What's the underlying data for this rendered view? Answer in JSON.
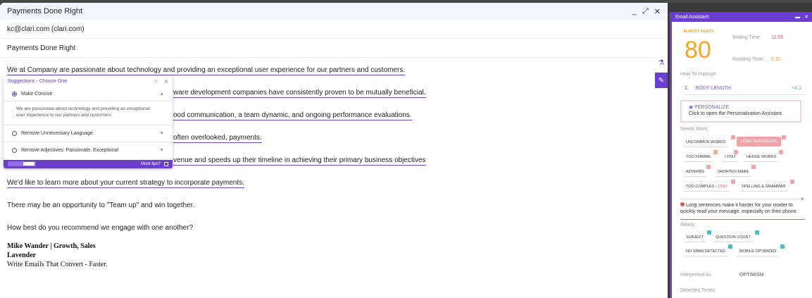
{
  "compose": {
    "title": "Payments Done Right",
    "to": "kc@clari.com (clari.com)",
    "subject": "Payments Done Right",
    "paragraphs": [
      "We at Company are passionate about technology and providing an exceptional user experience for our partners and customers.",
      "ware development companies have consistently proven to be mutually beneficial.",
      "ood communication, a team dynamic, and ongoing performance evaluations.",
      "often overlooked, payments.",
      "venue and speeds up their timeline in achieving their primary business objectives",
      "We'd like to learn more about your current strategy to incorporate payments.",
      "There may be an opportunity to \"Team up\" and win together.",
      "How best do you recommend we engage with one another?"
    ],
    "signature": {
      "name": "Mike Wander | Growth, Sales",
      "company": "Lavender",
      "tagline": "Write Emails That Convert - Faster."
    }
  },
  "suggestions": {
    "title": "Suggestions - Choose One",
    "options": [
      {
        "label": "Make Concise",
        "selected": true
      },
      {
        "label": "Remove Unnecessary Language.",
        "selected": false
      },
      {
        "label": "Remove Adjectives: Passionate, Exceptional",
        "selected": false
      }
    ],
    "example": "We are passionate about technology and providing an exceptional user experience to our partners and customers",
    "footer": "More tips?"
  },
  "panel": {
    "title": "Email Assistant",
    "status": "ALMOST READY",
    "score": "80",
    "writing_time_label": "Writing Time:",
    "writing_time": "11:59",
    "reading_time_label": "Reading Time:",
    "reading_time": "0:35",
    "improve_label": "How To Improve:",
    "improve_num": "1.",
    "improve_item": "BODY LENGTH",
    "improve_delta": "+4.1",
    "personalize_title": "PERSONALIZE",
    "personalize_text": "Click to open the Personalization Assistant.",
    "needs_work_label": "Needs Work:",
    "needs_work": [
      "UNCOMMON WORDS",
      "LONG SENTENCES",
      "TOO FORMAL",
      "I:YOU",
      "HEDGE WORDS",
      "ADVERBS",
      "SHORTEN EMAIL",
      "TOO COMPLEX - ",
      "12/12",
      "SPELLING & GRAMMAR"
    ],
    "tip": "Long sentences make it harder for your reader to quickly read your message, especially on their phone.",
    "ready_label": "Ready:",
    "ready": [
      "SUBJECT",
      "QUESTION COUNT",
      "NO SPAM DETECTED",
      "MOBILE OPTIMIZED"
    ],
    "interpreted_label": "Interpreted As:",
    "interpreted_value": "OPTIMISM",
    "tones_label": "Detected Tones:"
  },
  "colors": {
    "accent": "#6a3fd0",
    "score": "#f5a623",
    "pink": "#f3a2a8",
    "green": "#46c0c8"
  }
}
